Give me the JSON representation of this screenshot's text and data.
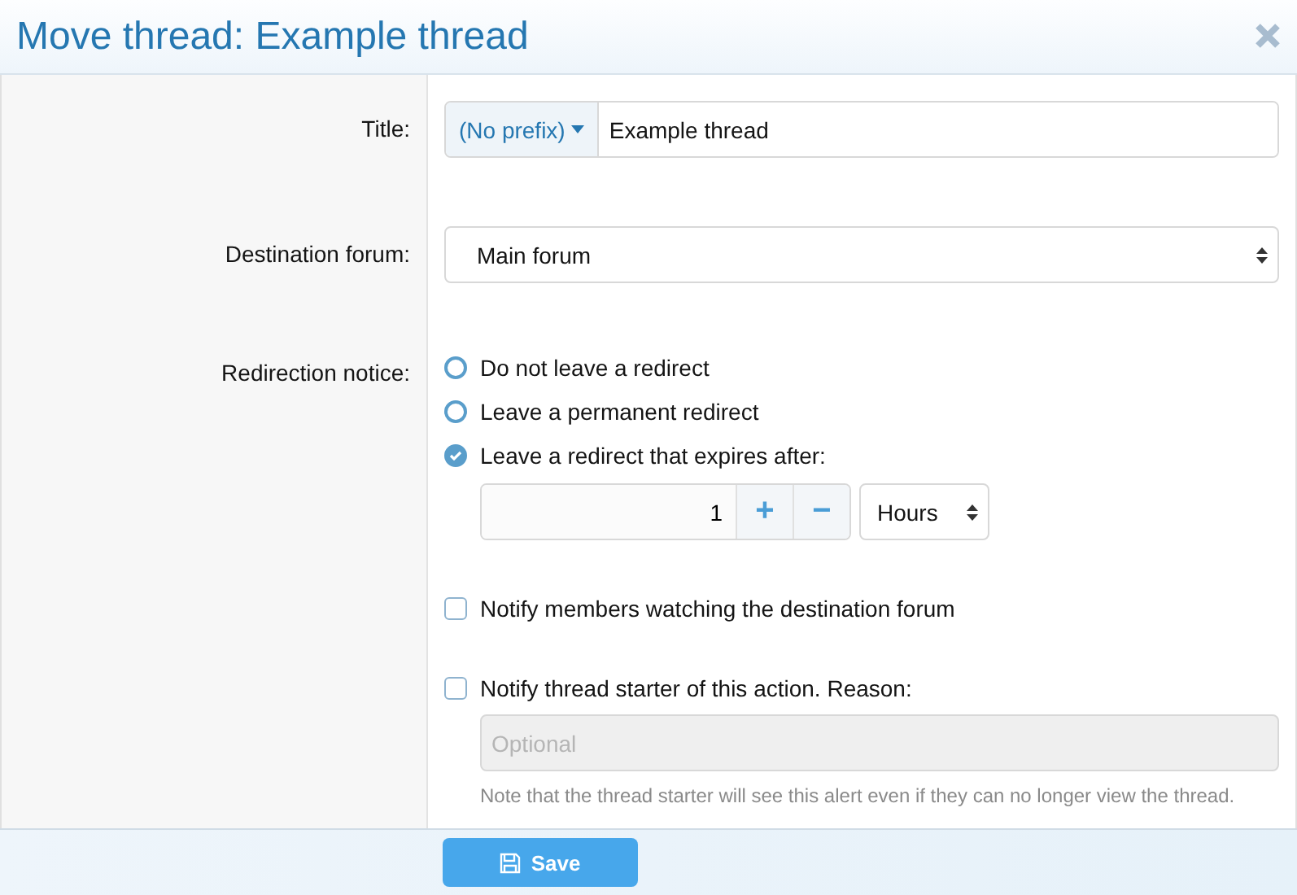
{
  "window": {
    "title": "Move thread: Example thread"
  },
  "title_row": {
    "label": "Title:",
    "prefix": "(No prefix)",
    "value": "Example thread"
  },
  "destination_row": {
    "label": "Destination forum:",
    "value": "Main forum"
  },
  "redirect_row": {
    "label": "Redirection notice:",
    "options": [
      {
        "label": "Do not leave a redirect",
        "selected": false
      },
      {
        "label": "Leave a permanent redirect",
        "selected": false
      },
      {
        "label": "Leave a redirect that expires after:",
        "selected": true
      }
    ],
    "amount": "1",
    "plus": "+",
    "minus": "−",
    "unit": "Hours"
  },
  "notify_watchers": {
    "label": "Notify members watching the destination forum",
    "checked": false
  },
  "notify_starter": {
    "label": "Notify thread starter of this action. Reason:",
    "checked": false,
    "placeholder": "Optional",
    "note": "Note that the thread starter will see this alert even if they can no longer view the thread."
  },
  "save_button": "Save"
}
